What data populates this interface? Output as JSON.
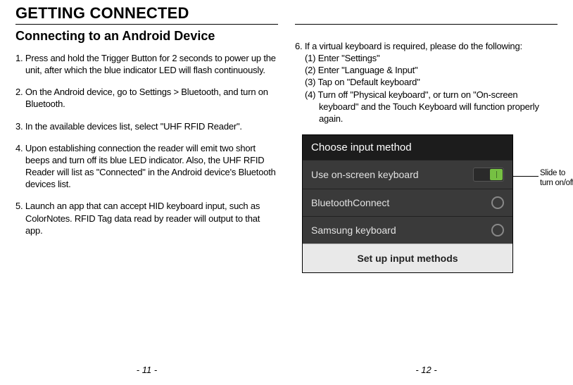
{
  "left": {
    "title": "GETTING CONNECTED",
    "subtitle": "Connecting to an Android Device",
    "steps": [
      "1. Press and hold the Trigger Button for 2 seconds to power up the unit, after which the blue indicator LED will flash continuously.",
      "2. On the Android device, go to Settings > Bluetooth, and turn on Bluetooth.",
      "3. In the available devices list, select \"UHF RFID Reader\".",
      "4. Upon establishing connection the reader will emit two short beeps and turn off its blue LED indicator. Also, the UHF RFID Reader will list as \"Connected\" in the Android device's Bluetooth devices list.",
      "5. Launch an app that can accept HID keyboard input, such as ColorNotes. RFID Tag data read by reader will output to that app."
    ],
    "page_num": "- 11 -"
  },
  "right": {
    "intro": "6. If a virtual keyboard is required, please do the following:",
    "subs": [
      "(1)  Enter \"Settings\"",
      "(2)  Enter \"Language & Input\"",
      "(3)  Tap on \"Default keyboard\"",
      "(4)  Turn off \"Physical keyboard\", or turn on \"On-screen keyboard\" and the Touch Keyboard will function properly again."
    ],
    "mock": {
      "header": "Choose input method",
      "row_toggle": "Use on-screen keyboard",
      "row_radio1": "BluetoothConnect",
      "row_radio2": "Samsung keyboard",
      "footer": "Set up input methods"
    },
    "callout": {
      "line1": "Slide to",
      "line2": "turn on/off"
    },
    "page_num": "- 12 -"
  }
}
